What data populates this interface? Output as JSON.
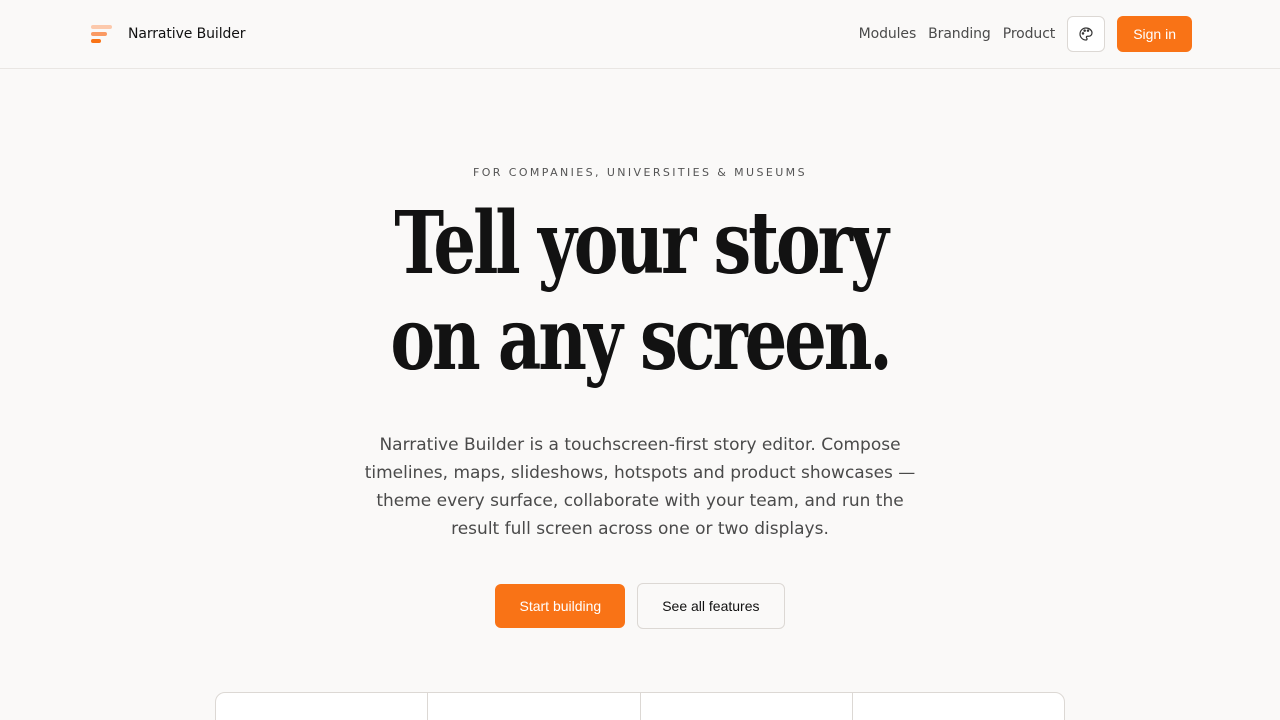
{
  "header": {
    "brand_name": "Narrative Builder",
    "nav": [
      "Modules",
      "Branding",
      "Product"
    ],
    "theme_icon": "palette-icon",
    "signin_label": "Sign in"
  },
  "hero": {
    "eyebrow": "FOR COMPANIES, UNIVERSITIES & MUSEUMS",
    "headline_line1": "Tell your story",
    "headline_line2": "on any screen.",
    "subtext": "Narrative Builder is a touchscreen-first story editor. Compose timelines, maps, slideshows, hotspots and product showcases — theme every surface, collaborate with your team, and run the result full screen across one or two displays.",
    "primary_cta": "Start building",
    "secondary_cta": "See all features"
  },
  "colors": {
    "accent": "#f97316",
    "background": "#faf9f8",
    "text": "#121212"
  }
}
